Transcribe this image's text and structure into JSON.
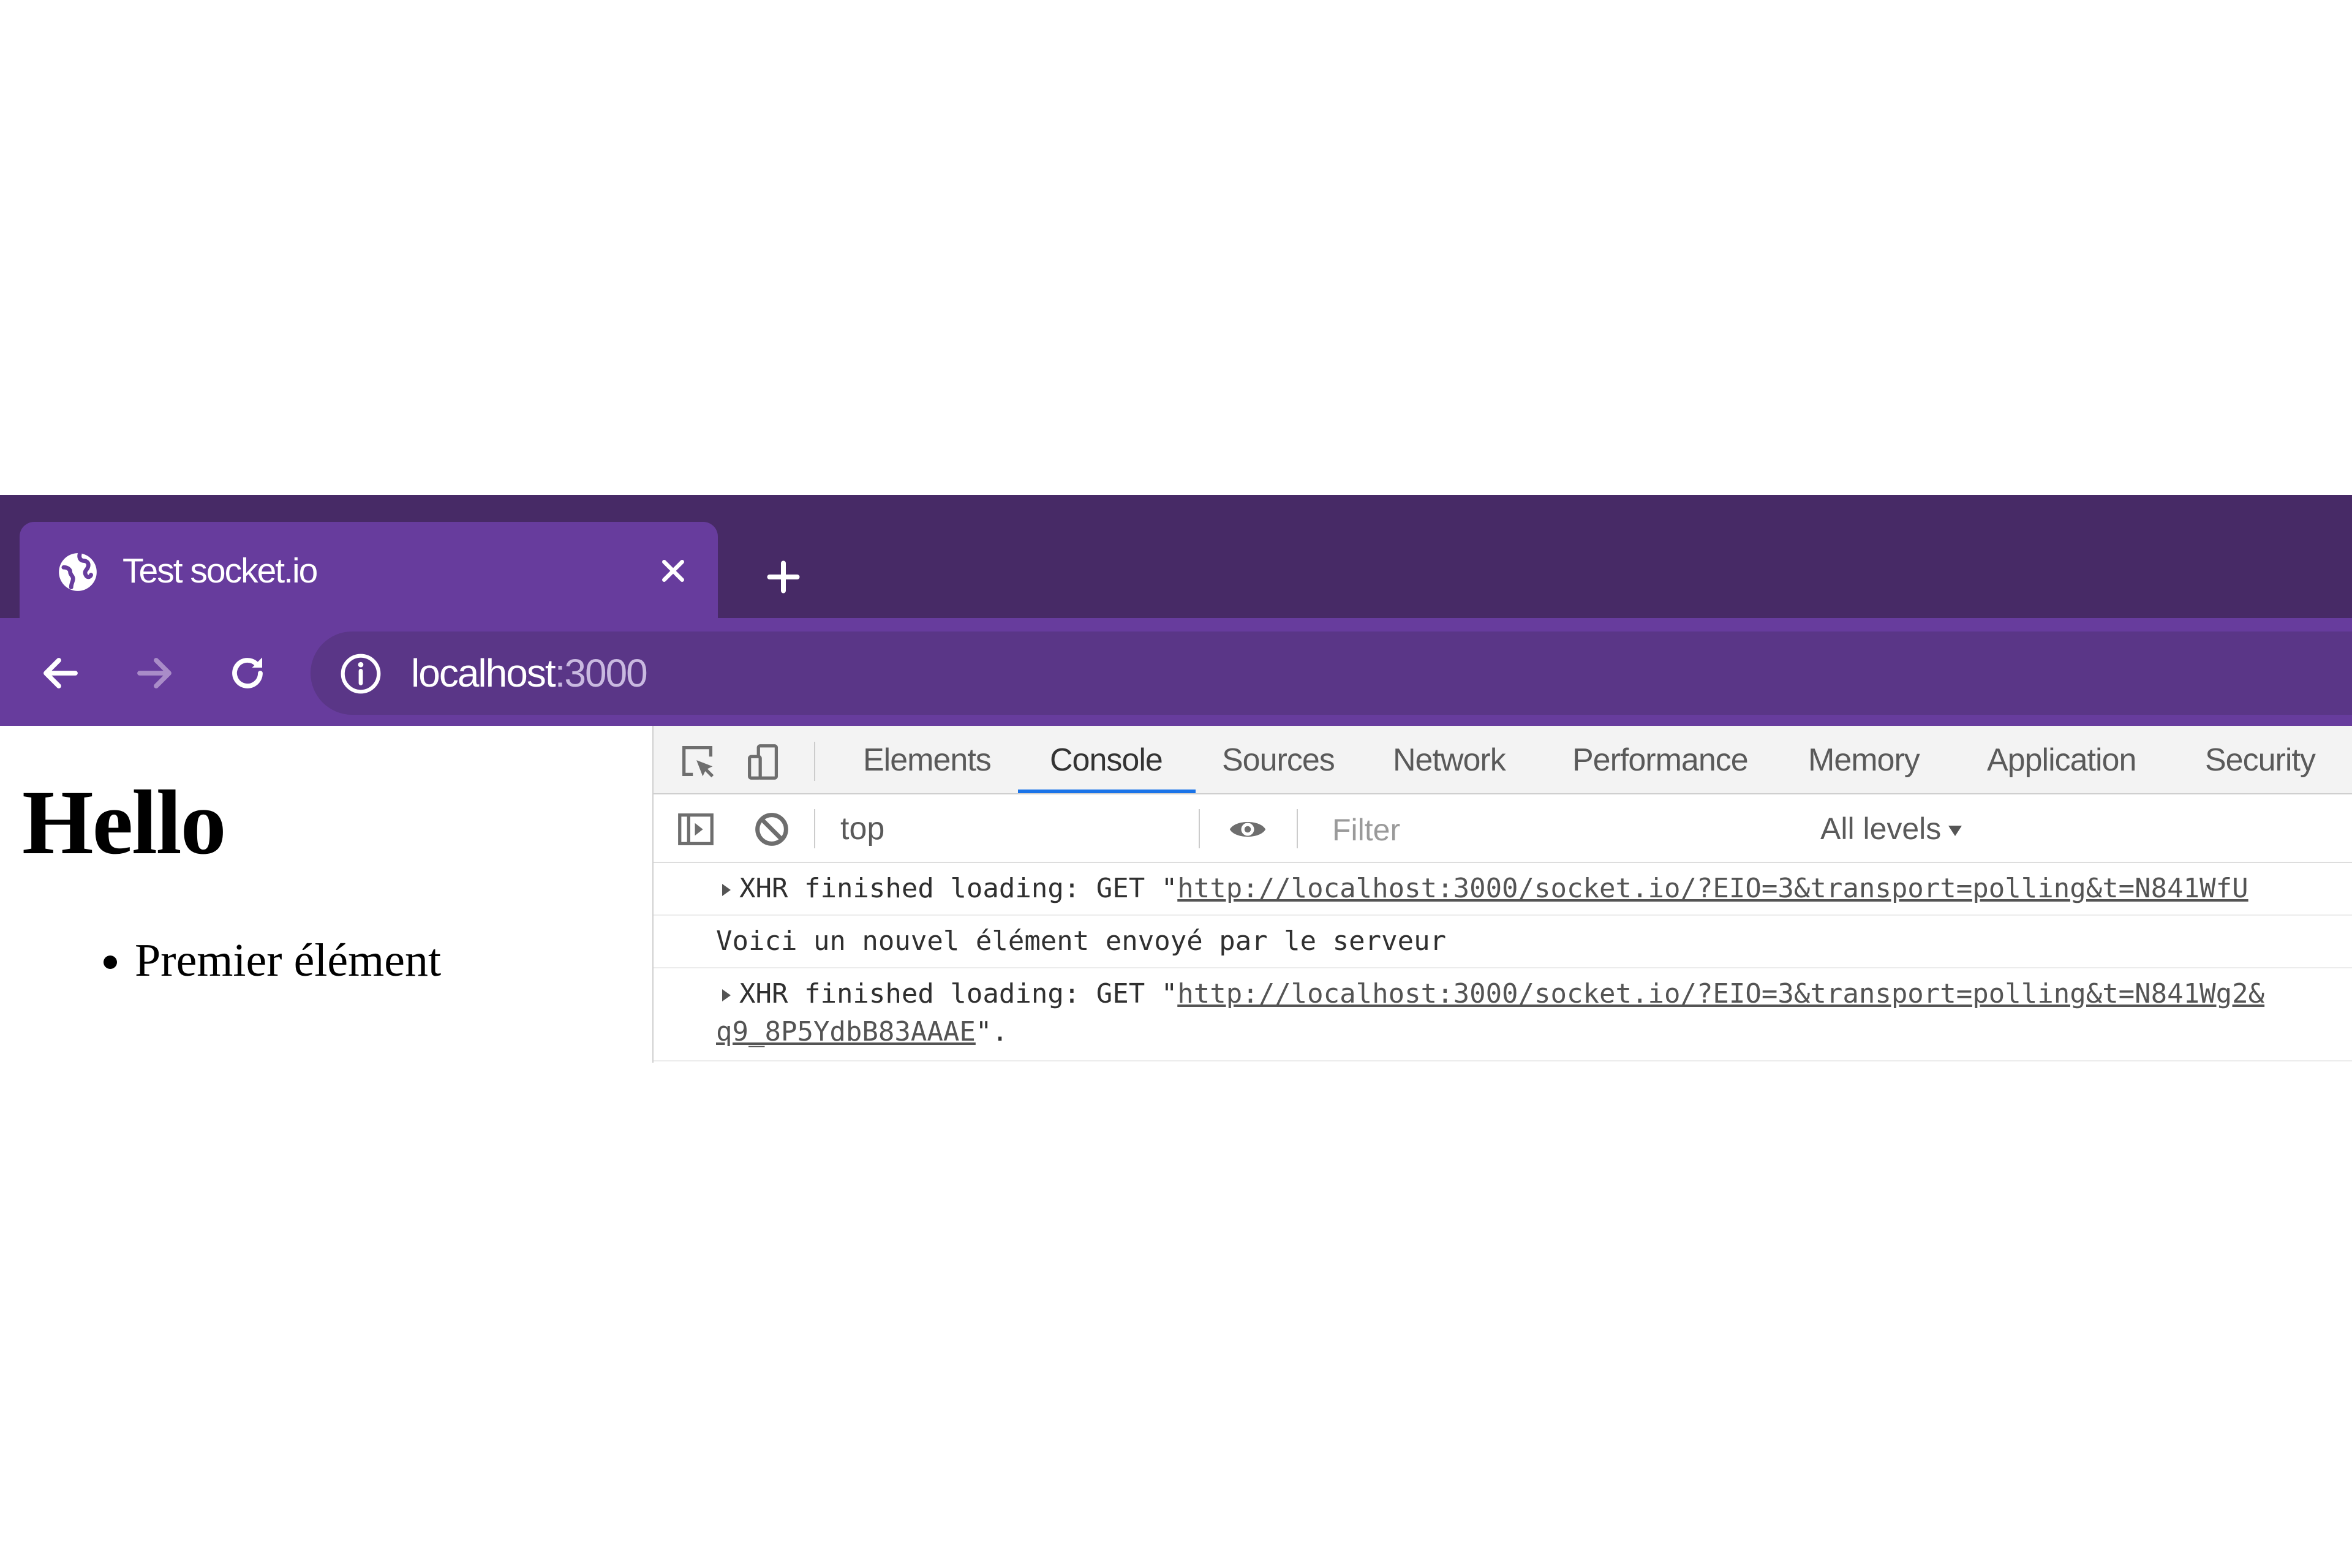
{
  "browser": {
    "tab": {
      "title": "Test socket.io"
    },
    "address": {
      "host": "localhost",
      "port": ":3000"
    }
  },
  "page": {
    "heading": "Hello",
    "list_items": [
      "Premier élément"
    ]
  },
  "devtools": {
    "tabs": [
      "Elements",
      "Console",
      "Sources",
      "Network",
      "Performance",
      "Memory",
      "Application",
      "Security"
    ],
    "active_tab": "Console",
    "context": "top",
    "filter_placeholder": "Filter",
    "levels": "All levels",
    "logs": [
      {
        "prefix": "XHR finished loading: GET \"",
        "link": "http://localhost:3000/socket.io/?EIO=3&transport=polling&t=N841WfU"
      },
      {
        "text": "Voici un nouvel élément envoyé par le serveur"
      },
      {
        "prefix": "XHR finished loading: GET \"",
        "link": "http://localhost:3000/socket.io/?EIO=3&transport=polling&t=N841Wg2&",
        "continuation_link": "q9_8P5YdbB83AAAE",
        "suffix": "\"."
      }
    ]
  }
}
